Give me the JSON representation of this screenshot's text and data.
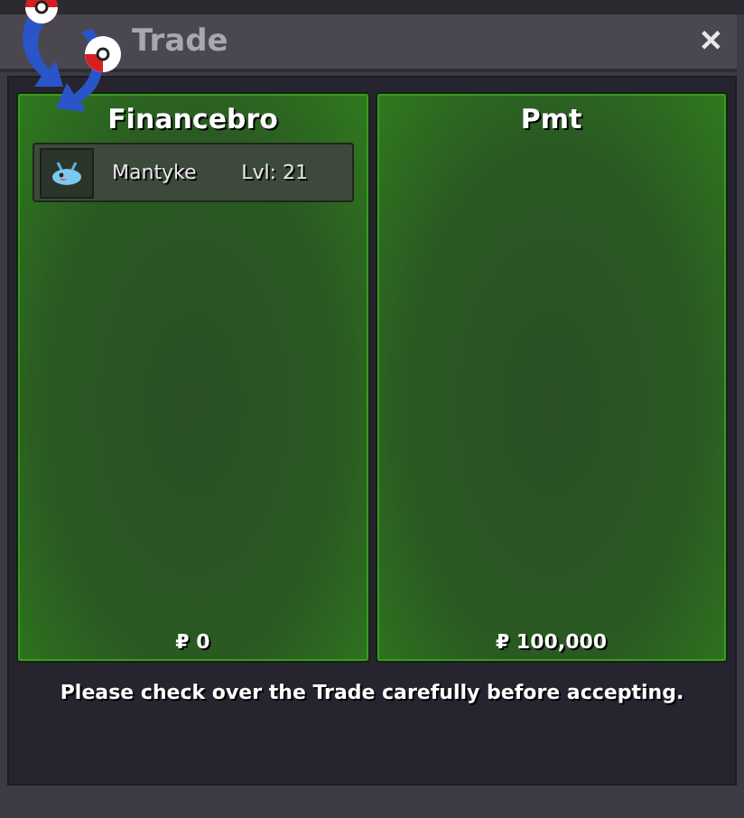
{
  "window": {
    "title": "Trade",
    "close": "✕"
  },
  "sides": [
    {
      "name": "Financebro",
      "items": [
        {
          "name": "Mantyke",
          "level": "Lvl: 21"
        }
      ],
      "money": "₽ 0"
    },
    {
      "name": "Pmt",
      "money": "₽ 100,000"
    }
  ],
  "notice": "Please check over the Trade carefully before accepting."
}
